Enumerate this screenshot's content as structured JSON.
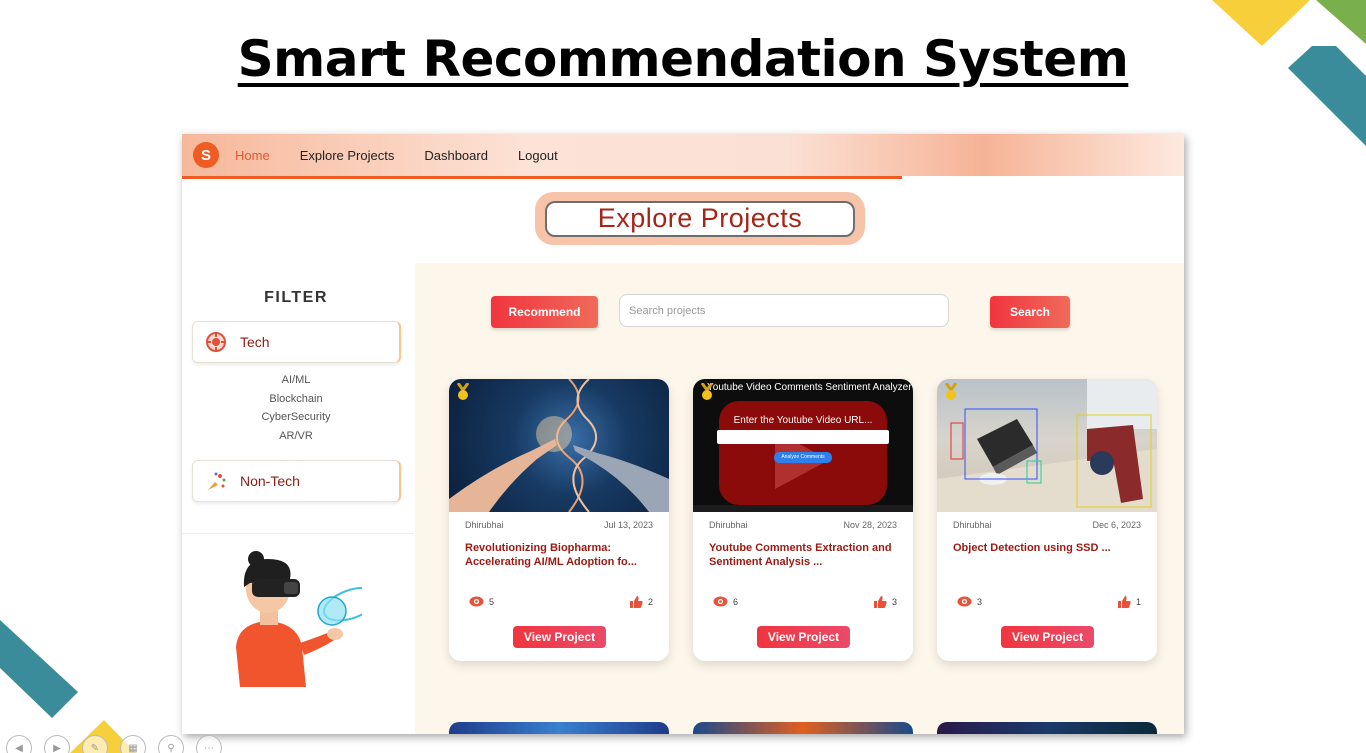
{
  "slide": {
    "title": "Smart Recommendation System",
    "colors": {
      "teal": "#3b8c9a",
      "yellow": "#f7cf3a",
      "green": "#7ab04c"
    }
  },
  "navbar": {
    "logo_glyph": "S",
    "items": [
      {
        "label": "Home",
        "active": true
      },
      {
        "label": "Explore Projects",
        "active": false
      },
      {
        "label": "Dashboard",
        "active": false
      },
      {
        "label": "Logout",
        "active": false
      }
    ]
  },
  "page": {
    "heading": "Explore Projects"
  },
  "filter": {
    "title": "FILTER",
    "categories": [
      {
        "label": "Tech",
        "icon": "tech-icon"
      },
      {
        "label": "Non-Tech",
        "icon": "non-tech-icon"
      }
    ],
    "tech_subcategories": [
      "AI/ML",
      "Blockchain",
      "CyberSecurity",
      "AR/VR"
    ]
  },
  "toolbar": {
    "recommend_label": "Recommend",
    "search_placeholder": "Search projects",
    "search_label": "Search"
  },
  "cards": [
    {
      "author": "Dhirubhai",
      "date": "Jul 13, 2023",
      "title": "Revolutionizing Biopharma: Accelerating AI/ML Adoption fo...",
      "views": "5",
      "likes": "2",
      "button": "View Project",
      "thumb_text": ""
    },
    {
      "author": "Dhirubhai",
      "date": "Nov 28, 2023",
      "title": "Youtube Comments Extraction and Sentiment Analysis ...",
      "views": "6",
      "likes": "3",
      "button": "View Project",
      "thumb_title": "Youtube Video Comments Sentiment Analyzer",
      "thumb_prompt": "Enter the Youtube Video URL...",
      "thumb_button": "Analyze Comments"
    },
    {
      "author": "Dhirubhai",
      "date": "Dec 6, 2023",
      "title": "Object Detection using SSD ...",
      "views": "3",
      "likes": "1",
      "button": "View Project",
      "thumb_text": ""
    }
  ]
}
